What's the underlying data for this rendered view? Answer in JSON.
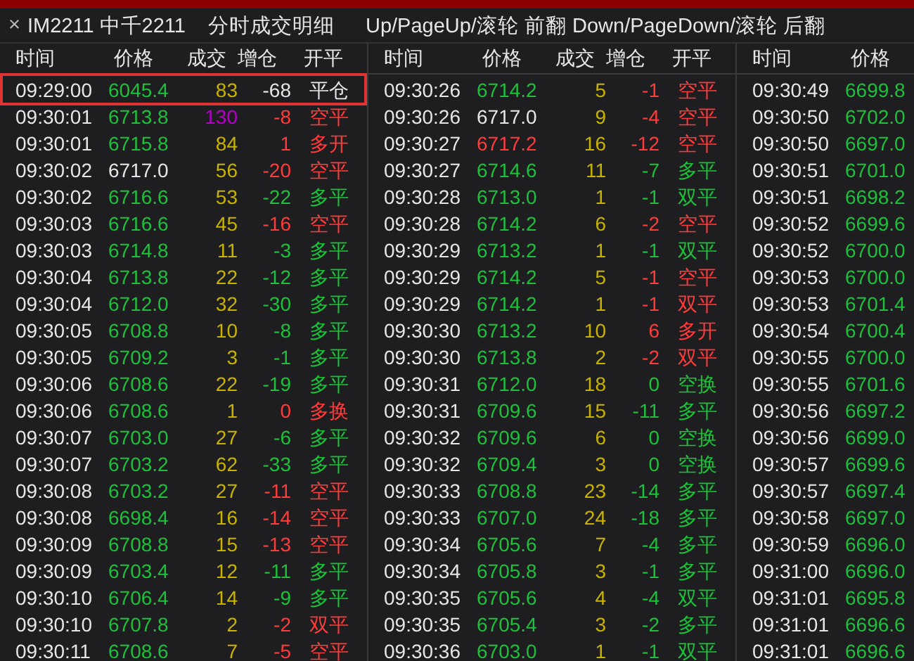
{
  "header": {
    "close": "×",
    "instrument": "IM2211 中千2211",
    "title": "分时成交明细",
    "hint": "Up/PageUp/滚轮 前翻 Down/PageDown/滚轮 后翻"
  },
  "panels": [
    {
      "columns": [
        "时间",
        "价格",
        "成交",
        "增仓",
        "开平"
      ],
      "rows": [
        {
          "time": "09:29:00",
          "price": {
            "text": "6045.4",
            "color": "#1ec03c"
          },
          "volume": {
            "text": "83",
            "color": "#c8b400"
          },
          "oi": {
            "text": "-68",
            "color": "#e6e6e6"
          },
          "type": {
            "text": "平仓",
            "color": "#e6e6e6"
          },
          "selected": true
        },
        {
          "time": "09:30:01",
          "price": {
            "text": "6713.8",
            "color": "#1ec03c"
          },
          "volume": {
            "text": "130",
            "color": "#b400c8"
          },
          "oi": {
            "text": "-8",
            "color": "#ff3c3c"
          },
          "type": {
            "text": "空平",
            "color": "#ff3c3c"
          },
          "selected": false
        },
        {
          "time": "09:30:01",
          "price": {
            "text": "6715.8",
            "color": "#1ec03c"
          },
          "volume": {
            "text": "84",
            "color": "#c8b400"
          },
          "oi": {
            "text": "1",
            "color": "#ff3c3c"
          },
          "type": {
            "text": "多开",
            "color": "#ff3c3c"
          },
          "selected": false
        },
        {
          "time": "09:30:02",
          "price": {
            "text": "6717.0",
            "color": "#e6e6e6"
          },
          "volume": {
            "text": "56",
            "color": "#c8b400"
          },
          "oi": {
            "text": "-20",
            "color": "#ff3c3c"
          },
          "type": {
            "text": "空平",
            "color": "#ff3c3c"
          },
          "selected": false
        },
        {
          "time": "09:30:02",
          "price": {
            "text": "6716.6",
            "color": "#1ec03c"
          },
          "volume": {
            "text": "53",
            "color": "#c8b400"
          },
          "oi": {
            "text": "-22",
            "color": "#1ec03c"
          },
          "type": {
            "text": "多平",
            "color": "#1ec03c"
          },
          "selected": false
        },
        {
          "time": "09:30:03",
          "price": {
            "text": "6716.6",
            "color": "#1ec03c"
          },
          "volume": {
            "text": "45",
            "color": "#c8b400"
          },
          "oi": {
            "text": "-16",
            "color": "#ff3c3c"
          },
          "type": {
            "text": "空平",
            "color": "#ff3c3c"
          },
          "selected": false
        },
        {
          "time": "09:30:03",
          "price": {
            "text": "6714.8",
            "color": "#1ec03c"
          },
          "volume": {
            "text": "11",
            "color": "#c8b400"
          },
          "oi": {
            "text": "-3",
            "color": "#1ec03c"
          },
          "type": {
            "text": "多平",
            "color": "#1ec03c"
          },
          "selected": false
        },
        {
          "time": "09:30:04",
          "price": {
            "text": "6713.8",
            "color": "#1ec03c"
          },
          "volume": {
            "text": "22",
            "color": "#c8b400"
          },
          "oi": {
            "text": "-12",
            "color": "#1ec03c"
          },
          "type": {
            "text": "多平",
            "color": "#1ec03c"
          },
          "selected": false
        },
        {
          "time": "09:30:04",
          "price": {
            "text": "6712.0",
            "color": "#1ec03c"
          },
          "volume": {
            "text": "32",
            "color": "#c8b400"
          },
          "oi": {
            "text": "-30",
            "color": "#1ec03c"
          },
          "type": {
            "text": "多平",
            "color": "#1ec03c"
          },
          "selected": false
        },
        {
          "time": "09:30:05",
          "price": {
            "text": "6708.8",
            "color": "#1ec03c"
          },
          "volume": {
            "text": "10",
            "color": "#c8b400"
          },
          "oi": {
            "text": "-8",
            "color": "#1ec03c"
          },
          "type": {
            "text": "多平",
            "color": "#1ec03c"
          },
          "selected": false
        },
        {
          "time": "09:30:05",
          "price": {
            "text": "6709.2",
            "color": "#1ec03c"
          },
          "volume": {
            "text": "3",
            "color": "#c8b400"
          },
          "oi": {
            "text": "-1",
            "color": "#1ec03c"
          },
          "type": {
            "text": "多平",
            "color": "#1ec03c"
          },
          "selected": false
        },
        {
          "time": "09:30:06",
          "price": {
            "text": "6708.6",
            "color": "#1ec03c"
          },
          "volume": {
            "text": "22",
            "color": "#c8b400"
          },
          "oi": {
            "text": "-19",
            "color": "#1ec03c"
          },
          "type": {
            "text": "多平",
            "color": "#1ec03c"
          },
          "selected": false
        },
        {
          "time": "09:30:06",
          "price": {
            "text": "6708.6",
            "color": "#1ec03c"
          },
          "volume": {
            "text": "1",
            "color": "#c8b400"
          },
          "oi": {
            "text": "0",
            "color": "#ff3c3c"
          },
          "type": {
            "text": "多换",
            "color": "#ff3c3c"
          },
          "selected": false
        },
        {
          "time": "09:30:07",
          "price": {
            "text": "6703.0",
            "color": "#1ec03c"
          },
          "volume": {
            "text": "27",
            "color": "#c8b400"
          },
          "oi": {
            "text": "-6",
            "color": "#1ec03c"
          },
          "type": {
            "text": "多平",
            "color": "#1ec03c"
          },
          "selected": false
        },
        {
          "time": "09:30:07",
          "price": {
            "text": "6703.2",
            "color": "#1ec03c"
          },
          "volume": {
            "text": "62",
            "color": "#c8b400"
          },
          "oi": {
            "text": "-33",
            "color": "#1ec03c"
          },
          "type": {
            "text": "多平",
            "color": "#1ec03c"
          },
          "selected": false
        },
        {
          "time": "09:30:08",
          "price": {
            "text": "6703.2",
            "color": "#1ec03c"
          },
          "volume": {
            "text": "27",
            "color": "#c8b400"
          },
          "oi": {
            "text": "-11",
            "color": "#ff3c3c"
          },
          "type": {
            "text": "空平",
            "color": "#ff3c3c"
          },
          "selected": false
        },
        {
          "time": "09:30:08",
          "price": {
            "text": "6698.4",
            "color": "#1ec03c"
          },
          "volume": {
            "text": "16",
            "color": "#c8b400"
          },
          "oi": {
            "text": "-14",
            "color": "#ff3c3c"
          },
          "type": {
            "text": "空平",
            "color": "#ff3c3c"
          },
          "selected": false
        },
        {
          "time": "09:30:09",
          "price": {
            "text": "6708.8",
            "color": "#1ec03c"
          },
          "volume": {
            "text": "15",
            "color": "#c8b400"
          },
          "oi": {
            "text": "-13",
            "color": "#ff3c3c"
          },
          "type": {
            "text": "空平",
            "color": "#ff3c3c"
          },
          "selected": false
        },
        {
          "time": "09:30:09",
          "price": {
            "text": "6703.4",
            "color": "#1ec03c"
          },
          "volume": {
            "text": "12",
            "color": "#c8b400"
          },
          "oi": {
            "text": "-11",
            "color": "#1ec03c"
          },
          "type": {
            "text": "多平",
            "color": "#1ec03c"
          },
          "selected": false
        },
        {
          "time": "09:30:10",
          "price": {
            "text": "6706.4",
            "color": "#1ec03c"
          },
          "volume": {
            "text": "14",
            "color": "#c8b400"
          },
          "oi": {
            "text": "-9",
            "color": "#1ec03c"
          },
          "type": {
            "text": "多平",
            "color": "#1ec03c"
          },
          "selected": false
        },
        {
          "time": "09:30:10",
          "price": {
            "text": "6707.8",
            "color": "#1ec03c"
          },
          "volume": {
            "text": "2",
            "color": "#c8b400"
          },
          "oi": {
            "text": "-2",
            "color": "#ff3c3c"
          },
          "type": {
            "text": "双平",
            "color": "#ff3c3c"
          },
          "selected": false
        },
        {
          "time": "09:30:11",
          "price": {
            "text": "6708.6",
            "color": "#1ec03c"
          },
          "volume": {
            "text": "7",
            "color": "#c8b400"
          },
          "oi": {
            "text": "-5",
            "color": "#ff3c3c"
          },
          "type": {
            "text": "空平",
            "color": "#ff3c3c"
          },
          "selected": false
        }
      ]
    },
    {
      "columns": [
        "时间",
        "价格",
        "成交",
        "增仓",
        "开平"
      ],
      "rows": [
        {
          "time": "09:30:26",
          "price": {
            "text": "6714.2",
            "color": "#1ec03c"
          },
          "volume": {
            "text": "5",
            "color": "#c8b400"
          },
          "oi": {
            "text": "-1",
            "color": "#ff3c3c"
          },
          "type": {
            "text": "空平",
            "color": "#ff3c3c"
          },
          "selected": false
        },
        {
          "time": "09:30:26",
          "price": {
            "text": "6717.0",
            "color": "#e6e6e6"
          },
          "volume": {
            "text": "9",
            "color": "#c8b400"
          },
          "oi": {
            "text": "-4",
            "color": "#ff3c3c"
          },
          "type": {
            "text": "空平",
            "color": "#ff3c3c"
          },
          "selected": false
        },
        {
          "time": "09:30:27",
          "price": {
            "text": "6717.2",
            "color": "#ff3c3c"
          },
          "volume": {
            "text": "16",
            "color": "#c8b400"
          },
          "oi": {
            "text": "-12",
            "color": "#ff3c3c"
          },
          "type": {
            "text": "空平",
            "color": "#ff3c3c"
          },
          "selected": false
        },
        {
          "time": "09:30:27",
          "price": {
            "text": "6714.6",
            "color": "#1ec03c"
          },
          "volume": {
            "text": "11",
            "color": "#c8b400"
          },
          "oi": {
            "text": "-7",
            "color": "#1ec03c"
          },
          "type": {
            "text": "多平",
            "color": "#1ec03c"
          },
          "selected": false
        },
        {
          "time": "09:30:28",
          "price": {
            "text": "6713.0",
            "color": "#1ec03c"
          },
          "volume": {
            "text": "1",
            "color": "#c8b400"
          },
          "oi": {
            "text": "-1",
            "color": "#1ec03c"
          },
          "type": {
            "text": "双平",
            "color": "#1ec03c"
          },
          "selected": false
        },
        {
          "time": "09:30:28",
          "price": {
            "text": "6714.2",
            "color": "#1ec03c"
          },
          "volume": {
            "text": "6",
            "color": "#c8b400"
          },
          "oi": {
            "text": "-2",
            "color": "#ff3c3c"
          },
          "type": {
            "text": "空平",
            "color": "#ff3c3c"
          },
          "selected": false
        },
        {
          "time": "09:30:29",
          "price": {
            "text": "6713.2",
            "color": "#1ec03c"
          },
          "volume": {
            "text": "1",
            "color": "#c8b400"
          },
          "oi": {
            "text": "-1",
            "color": "#1ec03c"
          },
          "type": {
            "text": "双平",
            "color": "#1ec03c"
          },
          "selected": false
        },
        {
          "time": "09:30:29",
          "price": {
            "text": "6714.2",
            "color": "#1ec03c"
          },
          "volume": {
            "text": "5",
            "color": "#c8b400"
          },
          "oi": {
            "text": "-1",
            "color": "#ff3c3c"
          },
          "type": {
            "text": "空平",
            "color": "#ff3c3c"
          },
          "selected": false
        },
        {
          "time": "09:30:29",
          "price": {
            "text": "6714.2",
            "color": "#1ec03c"
          },
          "volume": {
            "text": "1",
            "color": "#c8b400"
          },
          "oi": {
            "text": "-1",
            "color": "#ff3c3c"
          },
          "type": {
            "text": "双平",
            "color": "#ff3c3c"
          },
          "selected": false
        },
        {
          "time": "09:30:30",
          "price": {
            "text": "6713.2",
            "color": "#1ec03c"
          },
          "volume": {
            "text": "10",
            "color": "#c8b400"
          },
          "oi": {
            "text": "6",
            "color": "#ff3c3c"
          },
          "type": {
            "text": "多开",
            "color": "#ff3c3c"
          },
          "selected": false
        },
        {
          "time": "09:30:30",
          "price": {
            "text": "6713.8",
            "color": "#1ec03c"
          },
          "volume": {
            "text": "2",
            "color": "#c8b400"
          },
          "oi": {
            "text": "-2",
            "color": "#ff3c3c"
          },
          "type": {
            "text": "双平",
            "color": "#ff3c3c"
          },
          "selected": false
        },
        {
          "time": "09:30:31",
          "price": {
            "text": "6712.0",
            "color": "#1ec03c"
          },
          "volume": {
            "text": "18",
            "color": "#c8b400"
          },
          "oi": {
            "text": "0",
            "color": "#1ec03c"
          },
          "type": {
            "text": "空换",
            "color": "#1ec03c"
          },
          "selected": false
        },
        {
          "time": "09:30:31",
          "price": {
            "text": "6709.6",
            "color": "#1ec03c"
          },
          "volume": {
            "text": "15",
            "color": "#c8b400"
          },
          "oi": {
            "text": "-11",
            "color": "#1ec03c"
          },
          "type": {
            "text": "多平",
            "color": "#1ec03c"
          },
          "selected": false
        },
        {
          "time": "09:30:32",
          "price": {
            "text": "6709.6",
            "color": "#1ec03c"
          },
          "volume": {
            "text": "6",
            "color": "#c8b400"
          },
          "oi": {
            "text": "0",
            "color": "#1ec03c"
          },
          "type": {
            "text": "空换",
            "color": "#1ec03c"
          },
          "selected": false
        },
        {
          "time": "09:30:32",
          "price": {
            "text": "6709.4",
            "color": "#1ec03c"
          },
          "volume": {
            "text": "3",
            "color": "#c8b400"
          },
          "oi": {
            "text": "0",
            "color": "#1ec03c"
          },
          "type": {
            "text": "空换",
            "color": "#1ec03c"
          },
          "selected": false
        },
        {
          "time": "09:30:33",
          "price": {
            "text": "6708.8",
            "color": "#1ec03c"
          },
          "volume": {
            "text": "23",
            "color": "#c8b400"
          },
          "oi": {
            "text": "-14",
            "color": "#1ec03c"
          },
          "type": {
            "text": "多平",
            "color": "#1ec03c"
          },
          "selected": false
        },
        {
          "time": "09:30:33",
          "price": {
            "text": "6707.0",
            "color": "#1ec03c"
          },
          "volume": {
            "text": "24",
            "color": "#c8b400"
          },
          "oi": {
            "text": "-18",
            "color": "#1ec03c"
          },
          "type": {
            "text": "多平",
            "color": "#1ec03c"
          },
          "selected": false
        },
        {
          "time": "09:30:34",
          "price": {
            "text": "6705.6",
            "color": "#1ec03c"
          },
          "volume": {
            "text": "7",
            "color": "#c8b400"
          },
          "oi": {
            "text": "-4",
            "color": "#1ec03c"
          },
          "type": {
            "text": "多平",
            "color": "#1ec03c"
          },
          "selected": false
        },
        {
          "time": "09:30:34",
          "price": {
            "text": "6705.8",
            "color": "#1ec03c"
          },
          "volume": {
            "text": "3",
            "color": "#c8b400"
          },
          "oi": {
            "text": "-1",
            "color": "#1ec03c"
          },
          "type": {
            "text": "多平",
            "color": "#1ec03c"
          },
          "selected": false
        },
        {
          "time": "09:30:35",
          "price": {
            "text": "6705.6",
            "color": "#1ec03c"
          },
          "volume": {
            "text": "4",
            "color": "#c8b400"
          },
          "oi": {
            "text": "-4",
            "color": "#1ec03c"
          },
          "type": {
            "text": "双平",
            "color": "#1ec03c"
          },
          "selected": false
        },
        {
          "time": "09:30:35",
          "price": {
            "text": "6705.4",
            "color": "#1ec03c"
          },
          "volume": {
            "text": "3",
            "color": "#c8b400"
          },
          "oi": {
            "text": "-2",
            "color": "#1ec03c"
          },
          "type": {
            "text": "多平",
            "color": "#1ec03c"
          },
          "selected": false
        },
        {
          "time": "09:30:36",
          "price": {
            "text": "6703.0",
            "color": "#1ec03c"
          },
          "volume": {
            "text": "1",
            "color": "#c8b400"
          },
          "oi": {
            "text": "-1",
            "color": "#1ec03c"
          },
          "type": {
            "text": "双平",
            "color": "#1ec03c"
          },
          "selected": false
        }
      ]
    },
    {
      "columns": [
        "时间",
        "价格"
      ],
      "rows": [
        {
          "time": "09:30:49",
          "price": {
            "text": "6699.8",
            "color": "#1ec03c"
          },
          "selected": false
        },
        {
          "time": "09:30:50",
          "price": {
            "text": "6702.0",
            "color": "#1ec03c"
          },
          "selected": false
        },
        {
          "time": "09:30:50",
          "price": {
            "text": "6697.0",
            "color": "#1ec03c"
          },
          "selected": false
        },
        {
          "time": "09:30:51",
          "price": {
            "text": "6701.0",
            "color": "#1ec03c"
          },
          "selected": false
        },
        {
          "time": "09:30:51",
          "price": {
            "text": "6698.2",
            "color": "#1ec03c"
          },
          "selected": false
        },
        {
          "time": "09:30:52",
          "price": {
            "text": "6699.6",
            "color": "#1ec03c"
          },
          "selected": false
        },
        {
          "time": "09:30:52",
          "price": {
            "text": "6700.0",
            "color": "#1ec03c"
          },
          "selected": false
        },
        {
          "time": "09:30:53",
          "price": {
            "text": "6700.0",
            "color": "#1ec03c"
          },
          "selected": false
        },
        {
          "time": "09:30:53",
          "price": {
            "text": "6701.4",
            "color": "#1ec03c"
          },
          "selected": false
        },
        {
          "time": "09:30:54",
          "price": {
            "text": "6700.4",
            "color": "#1ec03c"
          },
          "selected": false
        },
        {
          "time": "09:30:55",
          "price": {
            "text": "6700.0",
            "color": "#1ec03c"
          },
          "selected": false
        },
        {
          "time": "09:30:55",
          "price": {
            "text": "6701.6",
            "color": "#1ec03c"
          },
          "selected": false
        },
        {
          "time": "09:30:56",
          "price": {
            "text": "6697.2",
            "color": "#1ec03c"
          },
          "selected": false
        },
        {
          "time": "09:30:56",
          "price": {
            "text": "6699.0",
            "color": "#1ec03c"
          },
          "selected": false
        },
        {
          "time": "09:30:57",
          "price": {
            "text": "6699.6",
            "color": "#1ec03c"
          },
          "selected": false
        },
        {
          "time": "09:30:57",
          "price": {
            "text": "6697.4",
            "color": "#1ec03c"
          },
          "selected": false
        },
        {
          "time": "09:30:58",
          "price": {
            "text": "6697.0",
            "color": "#1ec03c"
          },
          "selected": false
        },
        {
          "time": "09:30:59",
          "price": {
            "text": "6696.0",
            "color": "#1ec03c"
          },
          "selected": false
        },
        {
          "time": "09:31:00",
          "price": {
            "text": "6696.0",
            "color": "#1ec03c"
          },
          "selected": false
        },
        {
          "time": "09:31:01",
          "price": {
            "text": "6695.8",
            "color": "#1ec03c"
          },
          "selected": false
        },
        {
          "time": "09:31:01",
          "price": {
            "text": "6696.6",
            "color": "#1ec03c"
          },
          "selected": false
        },
        {
          "time": "09:31:01",
          "price": {
            "text": "6696.6",
            "color": "#1ec03c"
          },
          "selected": false
        }
      ]
    }
  ]
}
